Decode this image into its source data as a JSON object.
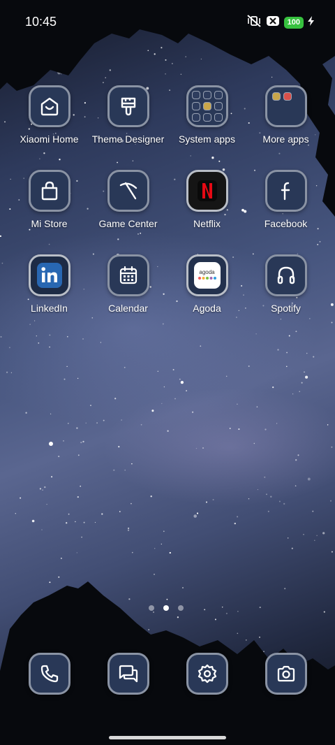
{
  "status_bar": {
    "time": "10:45",
    "battery_level": "100",
    "icons": [
      "vibrate-off-icon",
      "close-box-icon",
      "battery-icon",
      "charging-bolt-icon"
    ]
  },
  "apps": [
    {
      "label": "Xiaomi Home",
      "icon": "xiaomi-home-icon"
    },
    {
      "label": "Theme Designer",
      "icon": "paint-brush-icon"
    },
    {
      "label": "System apps",
      "icon": "folder-icon"
    },
    {
      "label": "More apps",
      "icon": "folder-icon"
    },
    {
      "label": "Mi Store",
      "icon": "shopping-bag-icon"
    },
    {
      "label": "Game Center",
      "icon": "pickaxe-icon"
    },
    {
      "label": "Netflix",
      "icon": "netflix-icon"
    },
    {
      "label": "Facebook",
      "icon": "facebook-icon"
    },
    {
      "label": "LinkedIn",
      "icon": "linkedin-icon"
    },
    {
      "label": "Calendar",
      "icon": "calendar-icon"
    },
    {
      "label": "Agoda",
      "icon": "agoda-icon"
    },
    {
      "label": "Spotify",
      "icon": "headphones-icon"
    }
  ],
  "agoda_logo_text": "agoda",
  "page_indicator": {
    "pages": 3,
    "current": 2
  },
  "dock": [
    "phone-icon",
    "messages-icon",
    "settings-icon",
    "camera-icon"
  ],
  "colors": {
    "icon_background": "#293857",
    "icon_border": "#8a93a4",
    "netflix_red": "#e50914",
    "linkedin_blue": "#2867b2",
    "battery_green": "#37c13f"
  }
}
